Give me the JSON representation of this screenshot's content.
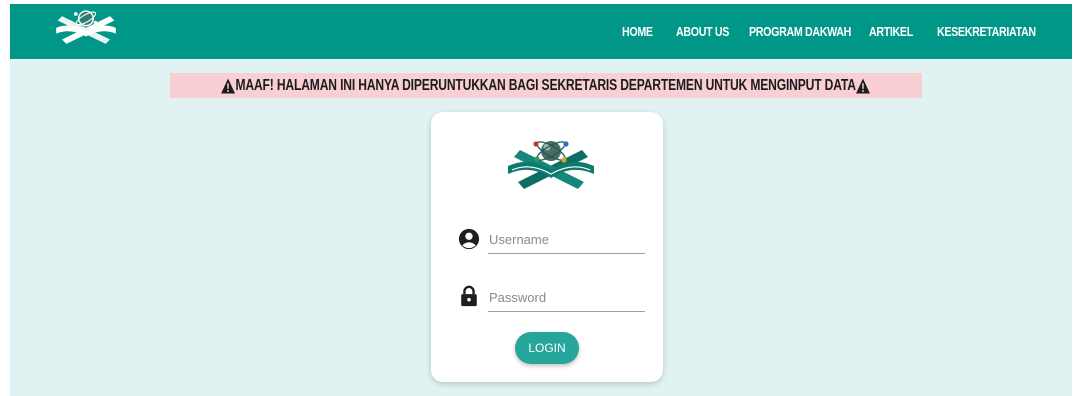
{
  "colors": {
    "nav": "#009688",
    "background": "#e0f2f1",
    "alert": "#f8d0d4",
    "button": "#26a69a"
  },
  "nav": {
    "logo_icon": "quran-stand-atom-logo",
    "items": [
      {
        "label": "HOME"
      },
      {
        "label": "ABOUT US"
      },
      {
        "label": "PROGRAM DAKWAH"
      },
      {
        "label": "ARTIKEL"
      },
      {
        "label": "KESEKRETARIATAN"
      }
    ]
  },
  "alert": {
    "icon": "warning-icon",
    "text": "MAAF! HALAMAN INI HANYA DIPERUNTUKKAN BAGI SEKRETARIS DEPARTEMEN UNTUK MENGINPUT DATA"
  },
  "login": {
    "logo_icon": "quran-stand-atom-logo",
    "username": {
      "icon": "user-circle-icon",
      "placeholder": "Username",
      "value": ""
    },
    "password": {
      "icon": "lock-icon",
      "placeholder": "Password",
      "value": ""
    },
    "button_label": "LOGIN"
  }
}
